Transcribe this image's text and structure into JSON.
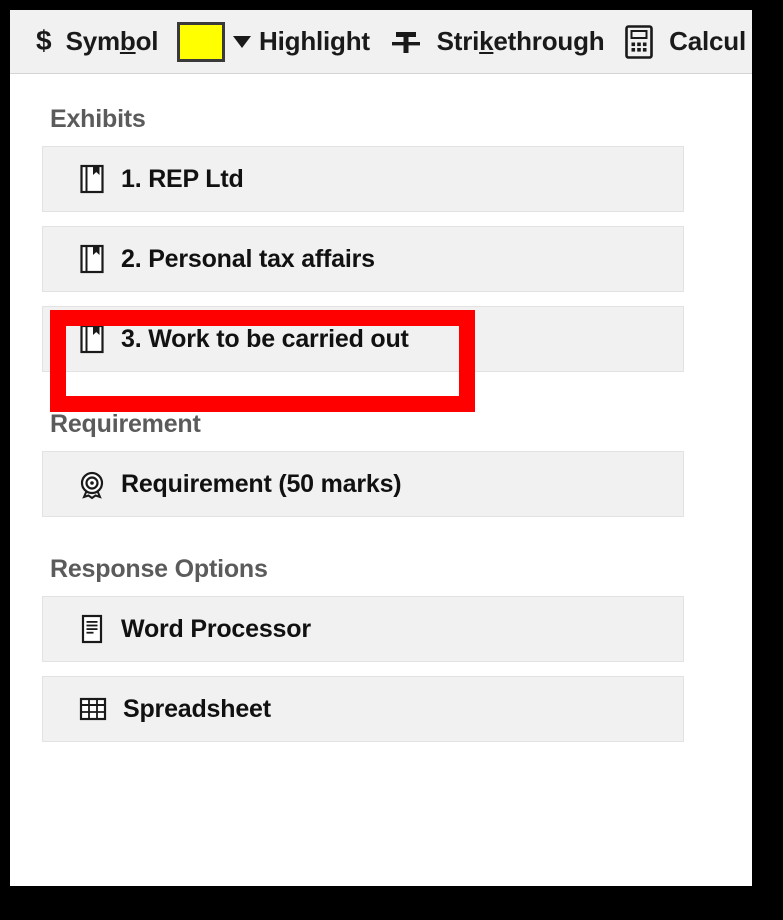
{
  "window": {
    "frame_color": "#000000",
    "background": "#ffffff"
  },
  "toolbar": {
    "background": "#f1f1f1",
    "items": [
      {
        "icon": "dollar-sign-icon",
        "label": "Symbol",
        "accel": "b",
        "label_before": "Sym",
        "label_after": "ol"
      },
      {
        "icon": "highlight-color-swatch",
        "swatch_color": "#FFFF00",
        "label": "Highlight",
        "accel": "",
        "dropdown": "chevron-down-icon"
      },
      {
        "icon": "strikethrough-icon",
        "label": "Strikethrough",
        "accel": "k",
        "label_before": "Stri",
        "label_after": "ethrough"
      },
      {
        "icon": "calculator-icon",
        "label": "Calcul",
        "truncated": true
      }
    ]
  },
  "content": {
    "sections": [
      {
        "title": "Exhibits",
        "items": [
          {
            "icon": "exhibit-book-icon",
            "label": "1. REP Ltd"
          },
          {
            "icon": "exhibit-book-icon",
            "label": "2. Personal tax affairs"
          },
          {
            "icon": "exhibit-book-icon",
            "label": "3. Work to be carried out",
            "highlighted": true
          }
        ]
      },
      {
        "title": "Requirement",
        "items": [
          {
            "icon": "requirement-rosette-icon",
            "label": "Requirement (50 marks)"
          }
        ]
      },
      {
        "title": "Response Options",
        "items": [
          {
            "icon": "word-processor-icon",
            "label": "Word Processor"
          },
          {
            "icon": "spreadsheet-grid-icon",
            "label": "Spreadsheet"
          }
        ]
      }
    ]
  },
  "annotation": {
    "type": "red-rectangle-highlight",
    "color": "#FF0000",
    "target": "3. Work to be carried out",
    "border_width_px": 16
  }
}
